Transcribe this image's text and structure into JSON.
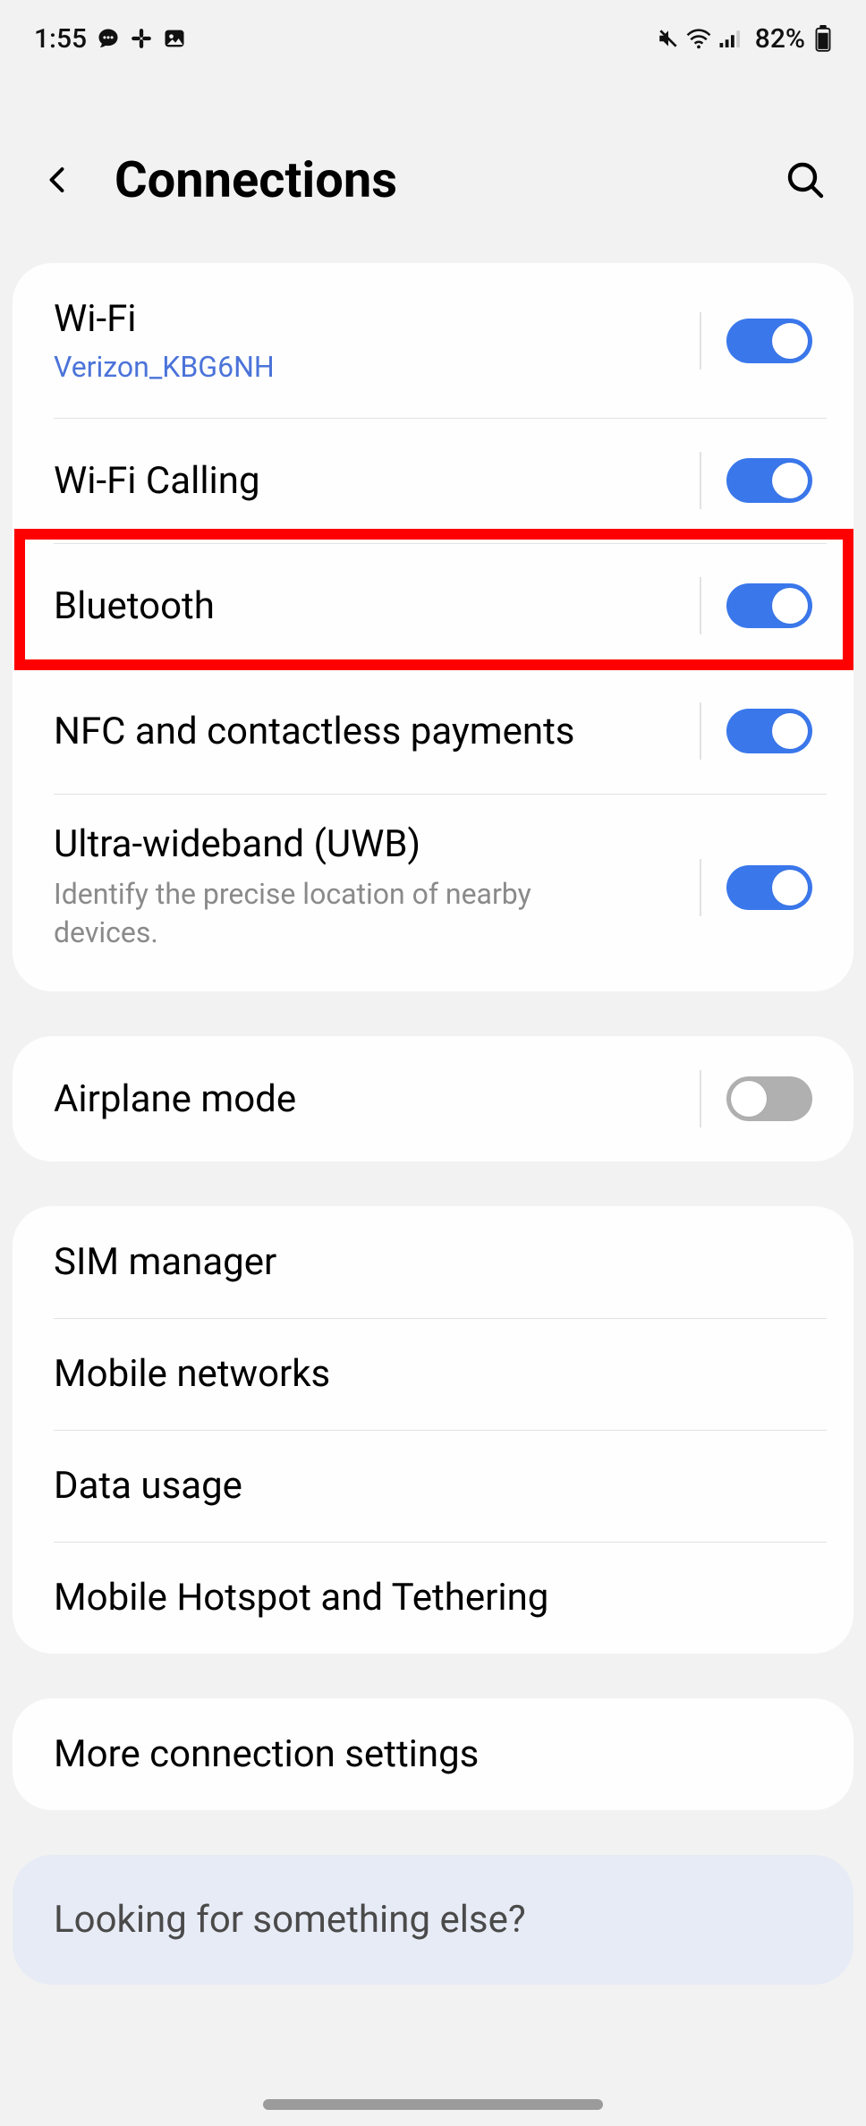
{
  "status": {
    "time": "1:55",
    "battery_percent": "82%"
  },
  "header": {
    "title": "Connections"
  },
  "group1": {
    "wifi": {
      "title": "Wi-Fi",
      "subtitle": "Verizon_KBG6NH",
      "on": true
    },
    "wifi_calling": {
      "title": "Wi-Fi Calling",
      "on": true
    },
    "bluetooth": {
      "title": "Bluetooth",
      "on": true
    },
    "nfc": {
      "title": "NFC and contactless payments",
      "on": true
    },
    "uwb": {
      "title": "Ultra-wideband (UWB)",
      "subtitle": "Identify the precise location of nearby devices.",
      "on": true
    }
  },
  "group2": {
    "airplane": {
      "title": "Airplane mode",
      "on": false
    }
  },
  "group3": {
    "sim": {
      "title": "SIM manager"
    },
    "mobile_networks": {
      "title": "Mobile networks"
    },
    "data_usage": {
      "title": "Data usage"
    },
    "hotspot": {
      "title": "Mobile Hotspot and Tethering"
    }
  },
  "group4": {
    "more": {
      "title": "More connection settings"
    }
  },
  "prompt": {
    "text": "Looking for something else?"
  }
}
